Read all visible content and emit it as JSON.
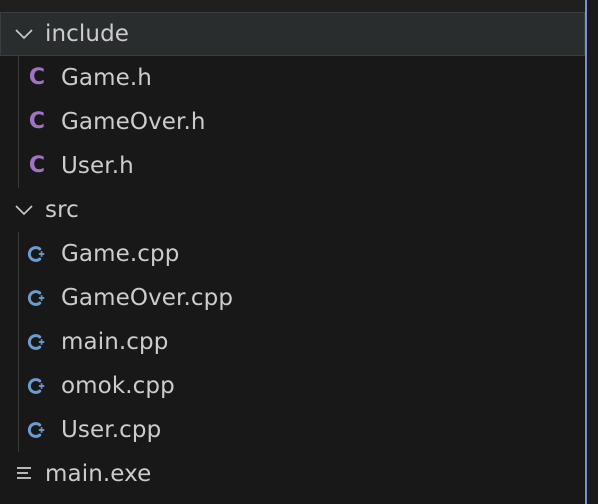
{
  "explorer": {
    "folders": [
      {
        "name": "include",
        "expanded": true,
        "selected": true,
        "files": [
          {
            "name": "Game.h",
            "icon": "c-header-icon"
          },
          {
            "name": "GameOver.h",
            "icon": "c-header-icon"
          },
          {
            "name": "User.h",
            "icon": "c-header-icon"
          }
        ]
      },
      {
        "name": "src",
        "expanded": true,
        "selected": false,
        "files": [
          {
            "name": "Game.cpp",
            "icon": "cpp-icon"
          },
          {
            "name": "GameOver.cpp",
            "icon": "cpp-icon"
          },
          {
            "name": "main.cpp",
            "icon": "cpp-icon"
          },
          {
            "name": "omok.cpp",
            "icon": "cpp-icon"
          },
          {
            "name": "User.cpp",
            "icon": "cpp-icon"
          }
        ]
      }
    ],
    "root_files": [
      {
        "name": "main.exe",
        "icon": "plain-file-icon"
      }
    ],
    "colors": {
      "background": "#181818",
      "text": "#cccccc",
      "c_header_icon": "#a074c4",
      "cpp_icon": "#6c9ccf",
      "selection_border": "#3a3d41",
      "indent_guide": "#3b3b3b",
      "focus_edge": "#7d8ed1"
    }
  }
}
